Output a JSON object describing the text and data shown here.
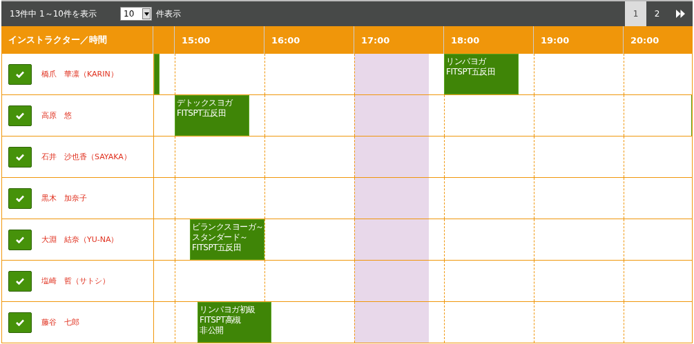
{
  "toolbar": {
    "summary": "13件中 1～10件を表示",
    "page_size": "10",
    "page_size_label": "件表示",
    "pages": [
      {
        "label": "1",
        "selected": true
      },
      {
        "label": "2",
        "selected": false
      }
    ]
  },
  "header": {
    "first_column": "インストラクター／時間",
    "hours": [
      "15:00",
      "16:00",
      "17:00",
      "18:00",
      "19:00",
      "20:00"
    ]
  },
  "rows": [
    {
      "name": "橋爪　華凛（KARIN）",
      "checked": true,
      "events": [
        {
          "kind": "sliver"
        },
        {
          "kind": "class",
          "lines": [
            "リンパヨガ",
            "FITSPT五反田"
          ]
        }
      ]
    },
    {
      "name": "高原　悠",
      "checked": true,
      "events": [
        {
          "kind": "class",
          "lines": [
            "デトックスヨガ",
            "FITSPT五反田"
          ]
        },
        {
          "kind": "sliver"
        }
      ]
    },
    {
      "name": "石井　沙也香（SAYAKA）",
      "checked": true
    },
    {
      "name": "黒木　加奈子",
      "checked": true
    },
    {
      "name": "大淵　結奈（YU-NA）",
      "checked": true,
      "events": [
        {
          "kind": "class",
          "lines": [
            "ビランクスヨーガ～",
            "スタンダード～",
            "FITSPT五反田"
          ]
        }
      ]
    },
    {
      "name": "塩崎　哲（サトシ）",
      "checked": true
    },
    {
      "name": "藤谷　七郎",
      "checked": true,
      "events": [
        {
          "kind": "class",
          "lines": [
            "リンパヨガ初級",
            "FITSPT高槻",
            "非公開"
          ]
        }
      ]
    }
  ]
}
